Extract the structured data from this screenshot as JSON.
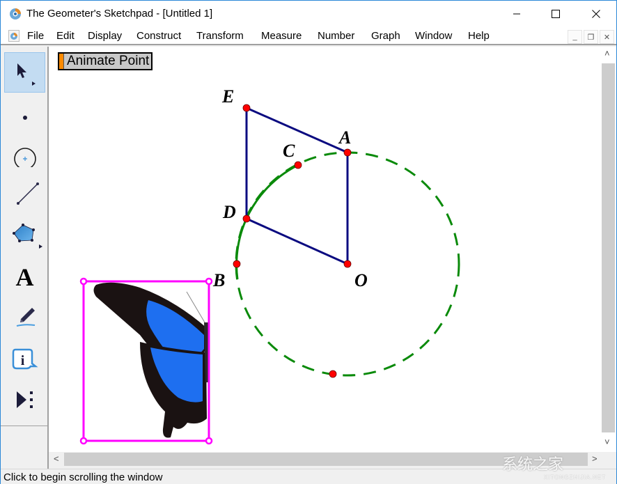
{
  "window": {
    "title": "The Geometer's Sketchpad - [Untitled 1]",
    "controls": {
      "minimize": "minimize-icon",
      "maximize": "maximize-icon",
      "close": "close-icon"
    }
  },
  "menu": {
    "items": [
      {
        "label": "File"
      },
      {
        "label": "Edit"
      },
      {
        "label": "Display"
      },
      {
        "label": "Construct"
      },
      {
        "label": "Transform"
      },
      {
        "label": "Measure"
      },
      {
        "label": "Number"
      },
      {
        "label": "Graph"
      },
      {
        "label": "Window"
      },
      {
        "label": "Help"
      }
    ],
    "mdi_controls": {
      "minimize": "_",
      "restore": "❐",
      "close": "✕"
    }
  },
  "toolbar": {
    "tools": [
      {
        "name": "selection-arrow-tool",
        "selected": true
      },
      {
        "name": "point-tool",
        "selected": false
      },
      {
        "name": "compass-tool",
        "selected": false
      },
      {
        "name": "straightedge-tool",
        "selected": false
      },
      {
        "name": "polygon-tool",
        "selected": false
      },
      {
        "name": "text-tool",
        "selected": false,
        "glyph": "A"
      },
      {
        "name": "marker-tool",
        "selected": false
      },
      {
        "name": "information-tool",
        "selected": false,
        "glyph": "i"
      },
      {
        "name": "custom-tool",
        "selected": false
      }
    ]
  },
  "canvas": {
    "action_button": {
      "label": "Animate Point",
      "handle_color": "#ff8a00"
    },
    "points": [
      {
        "label": "E"
      },
      {
        "label": "A"
      },
      {
        "label": "C"
      },
      {
        "label": "D"
      },
      {
        "label": "B"
      },
      {
        "label": "O"
      }
    ],
    "colors": {
      "point_fill": "#ff0000",
      "segment": "#0a0a80",
      "circle": "#0a8a0a",
      "image_frame": "#ff00ff",
      "butterfly_blue": "#1e6ff0",
      "butterfly_dark": "#1a1212"
    }
  },
  "scrollbars": {
    "up": "˄",
    "down": "˅",
    "left": "<",
    "right": ">"
  },
  "status": {
    "text": "Click to begin scrolling the window"
  },
  "watermark": {
    "text": "系统之家",
    "sub": "XITONGZHIJIA.NET"
  }
}
